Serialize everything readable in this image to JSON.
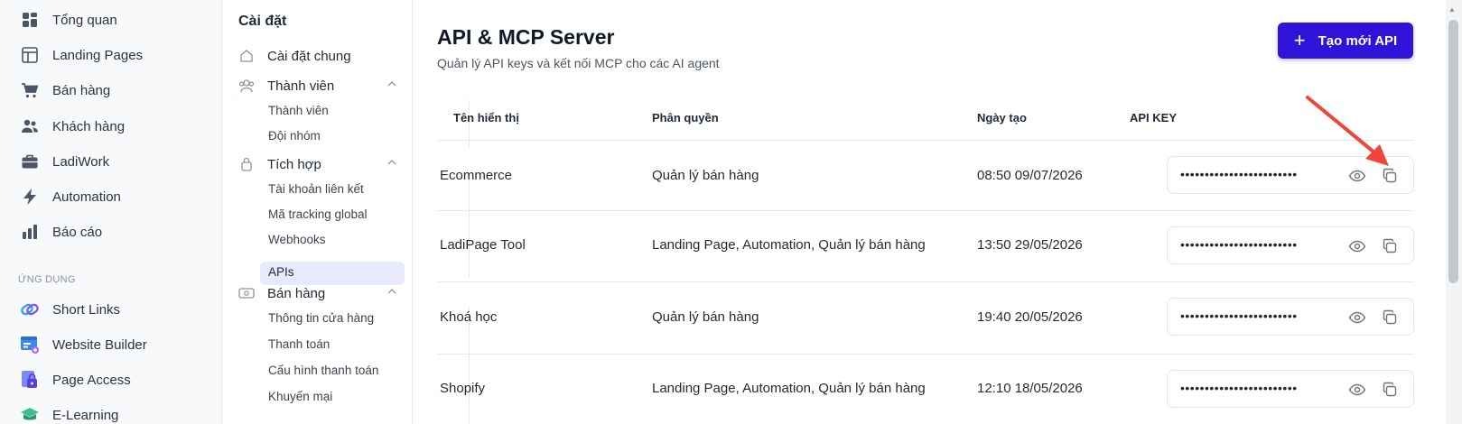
{
  "left_nav": {
    "items": [
      {
        "label": "Tổng quan",
        "icon": "grid-icon"
      },
      {
        "label": "Landing Pages",
        "icon": "layout-icon"
      },
      {
        "label": "Bán hàng",
        "icon": "cart-icon"
      },
      {
        "label": "Khách hàng",
        "icon": "users-icon"
      },
      {
        "label": "LadiWork",
        "icon": "briefcase-icon"
      },
      {
        "label": "Automation",
        "icon": "bolt-icon"
      },
      {
        "label": "Báo cáo",
        "icon": "bar-chart-icon"
      }
    ],
    "section_label": "ỨNG DỤNG",
    "apps": [
      {
        "label": "Short Links",
        "icon": "link-icon"
      },
      {
        "label": "Website Builder",
        "icon": "website-icon"
      },
      {
        "label": "Page Access",
        "icon": "lock-page-icon"
      },
      {
        "label": "E-Learning",
        "icon": "book-icon"
      }
    ]
  },
  "settings": {
    "title": "Cài đặt",
    "general": "Cài đặt chung",
    "members": {
      "label": "Thành viên",
      "items": [
        "Thành viên",
        "Đội nhóm"
      ]
    },
    "integration": {
      "label": "Tích hợp",
      "items": [
        "Tài khoản liên kết",
        "Mã tracking global",
        "Webhooks",
        "APIs"
      ]
    },
    "sales": {
      "label": "Bán hàng",
      "items": [
        "Thông tin cửa hàng",
        "Thanh toán",
        "Cấu hình thanh toán",
        "Khuyến mại"
      ]
    }
  },
  "main": {
    "title": "API & MCP Server",
    "subtitle": "Quản lý API keys và kết nối MCP cho các AI agent",
    "create_button": "Tạo mới API",
    "columns": [
      "Tên hiển thị",
      "Phân quyền",
      "Ngày tạo",
      "API KEY"
    ],
    "rows": [
      {
        "name": "Ecommerce",
        "permissions": "Quản lý bán hàng",
        "created": "08:50 09/07/2026",
        "key": "••••••••••••••••••••••••"
      },
      {
        "name": "LadiPage Tool",
        "permissions": "Landing Page, Automation, Quản lý bán hàng",
        "created": "13:50 29/05/2026",
        "key": "••••••••••••••••••••••••"
      },
      {
        "name": "Khoá học",
        "permissions": "Quản lý bán hàng",
        "created": "19:40 20/05/2026",
        "key": "••••••••••••••••••••••••"
      },
      {
        "name": "Shopify",
        "permissions": "Landing Page, Automation, Quản lý bán hàng",
        "created": "12:10 18/05/2026",
        "key": "••••••••••••••••••••••••"
      }
    ]
  },
  "colors": {
    "accent": "#2f13d9",
    "annotation": "#f0453a",
    "active_bg": "#e8eafc"
  }
}
